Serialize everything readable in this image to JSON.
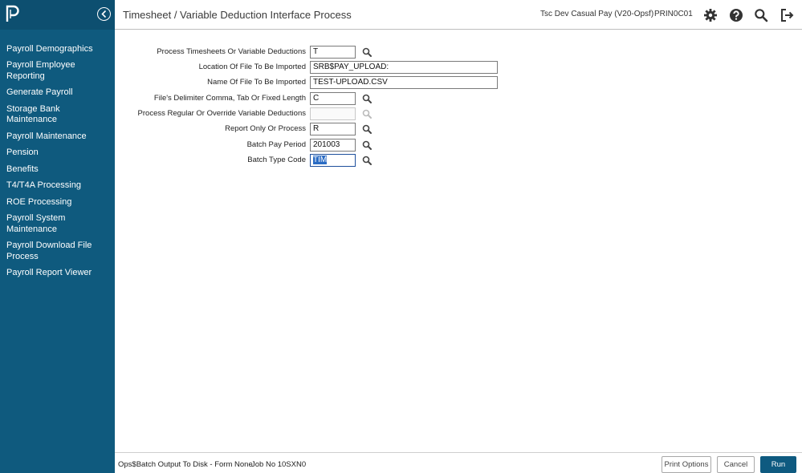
{
  "sidebar": {
    "items": [
      {
        "label": "Payroll Demographics",
        "name": "sidebar-item-payroll-demographics"
      },
      {
        "label": "Payroll Employee Reporting",
        "name": "sidebar-item-payroll-employee-reporting"
      },
      {
        "label": "Generate Payroll",
        "name": "sidebar-item-generate-payroll"
      },
      {
        "label": "Storage Bank Maintenance",
        "name": "sidebar-item-storage-bank-maintenance"
      },
      {
        "label": "Payroll Maintenance",
        "name": "sidebar-item-payroll-maintenance"
      },
      {
        "label": "Pension",
        "name": "sidebar-item-pension"
      },
      {
        "label": "Benefits",
        "name": "sidebar-item-benefits"
      },
      {
        "label": "T4/T4A Processing",
        "name": "sidebar-item-t4-t4a-processing"
      },
      {
        "label": "ROE Processing",
        "name": "sidebar-item-roe-processing"
      },
      {
        "label": "Payroll System Maintenance",
        "name": "sidebar-item-payroll-system-maintenance"
      },
      {
        "label": "Payroll Download File Process",
        "name": "sidebar-item-payroll-download-file-process"
      },
      {
        "label": "Payroll Report Viewer",
        "name": "sidebar-item-payroll-report-viewer"
      }
    ]
  },
  "header": {
    "title": "Timesheet / Variable Deduction Interface Process",
    "environment": "Tsc Dev Casual Pay (V20-Opsf)",
    "program": "PRIN0C01",
    "icons": [
      "gear-icon",
      "help-icon",
      "search-icon",
      "logout-icon"
    ]
  },
  "form": {
    "fields": [
      {
        "label": "Process Timesheets Or Variable Deductions",
        "value": "T",
        "lookup": true
      },
      {
        "label": "Location Of File To Be Imported",
        "value": "SRB$PAY_UPLOAD:",
        "lookup": false
      },
      {
        "label": "Name Of File To Be Imported",
        "value": "TEST-UPLOAD.CSV",
        "lookup": false
      },
      {
        "label": "File's Delimiter Comma, Tab Or Fixed Length",
        "value": "C",
        "lookup": true
      },
      {
        "label": "Process Regular Or Override Variable Deductions",
        "value": "",
        "lookup": true,
        "disabled": true
      },
      {
        "label": "Report Only Or Process",
        "value": "R",
        "lookup": true
      },
      {
        "label": "Batch Pay Period",
        "value": "201003",
        "lookup": true
      },
      {
        "label": "Batch Type Code",
        "value": "TIM",
        "lookup": true,
        "selected": true
      }
    ]
  },
  "footer": {
    "output": "Ops$Batch Output To Disk - Form None",
    "job": "Job No 10SXN0",
    "print_options_label": "Print Options",
    "cancel_label": "Cancel",
    "run_label": "Run"
  },
  "colors": {
    "sidebar": "#0f5a7e",
    "primary_button": "#0e5a80"
  }
}
